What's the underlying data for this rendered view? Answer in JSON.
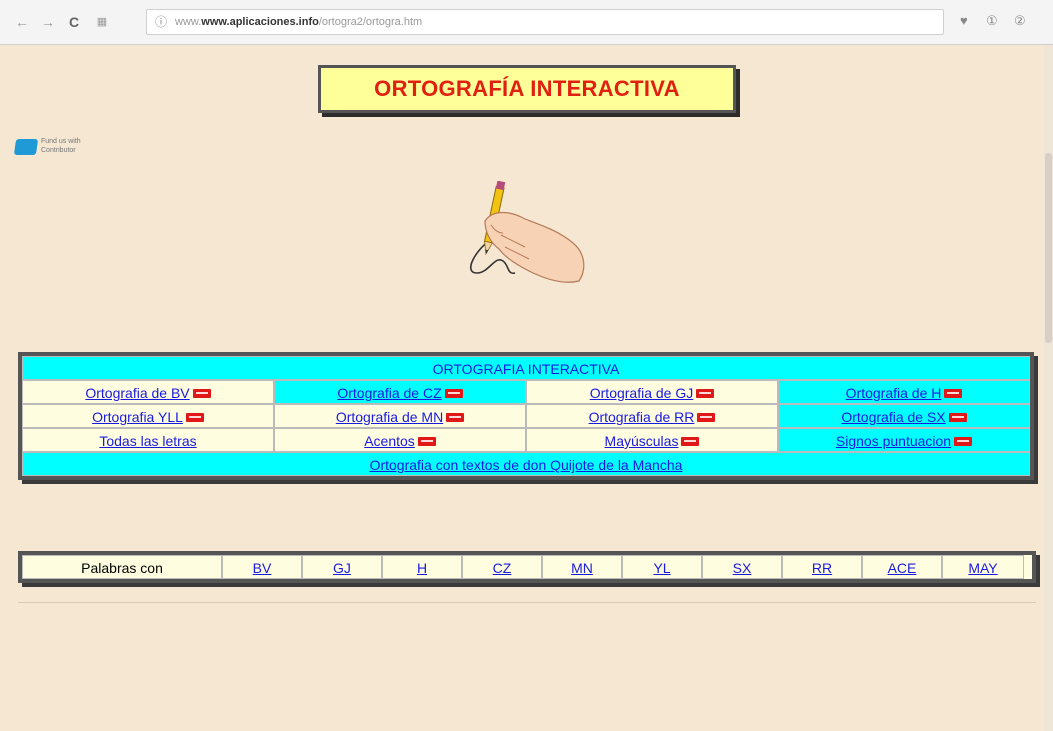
{
  "browser": {
    "url_domain": "www.aplicaciones.info",
    "url_path": "/ortogra2/ortogra.htm",
    "url_prefix": "www."
  },
  "page": {
    "title": "ORTOGRAFÍA INTERACTIVA",
    "contrib_badge": "Fund us with Contributor"
  },
  "main_table": {
    "header": "ORTOGRAFIA INTERACTIVA",
    "rows": [
      [
        {
          "label": "Ortografia de BV",
          "badge": true,
          "bg": "cream"
        },
        {
          "label": "Ortografia de CZ",
          "badge": true,
          "bg": "cyan"
        },
        {
          "label": "Ortografia de GJ",
          "badge": true,
          "bg": "cream"
        },
        {
          "label": "Ortografia de H",
          "badge": true,
          "bg": "cyan"
        }
      ],
      [
        {
          "label": "Ortografia YLL",
          "badge": true,
          "bg": "cream"
        },
        {
          "label": "Ortografia de MN",
          "badge": true,
          "bg": "cream"
        },
        {
          "label": "Ortografia de RR",
          "badge": true,
          "bg": "cream"
        },
        {
          "label": "Ortografia de SX",
          "badge": true,
          "bg": "cyan"
        }
      ],
      [
        {
          "label": "Todas las letras",
          "badge": false,
          "bg": "cream"
        },
        {
          "label": "Acentos",
          "badge": true,
          "bg": "cream"
        },
        {
          "label": "Mayúsculas",
          "badge": true,
          "bg": "cream"
        },
        {
          "label": "Signos puntuacion",
          "badge": true,
          "bg": "cyan"
        }
      ]
    ],
    "footer": "Ortografia con textos de don Quijote de la Mancha"
  },
  "words_table": {
    "label": "Palabras con",
    "links": [
      "BV",
      "GJ",
      "H",
      "CZ",
      "MN",
      "YL",
      "SX",
      "RR",
      "ACE",
      "MAY"
    ]
  },
  "colors": {
    "background": "#f5e7d2",
    "title_text": "#e02010",
    "title_bg": "#ffff99",
    "cyan": "#00ffff",
    "cream": "#fffde0",
    "link": "#1a1adf",
    "badge": "#e01818"
  }
}
